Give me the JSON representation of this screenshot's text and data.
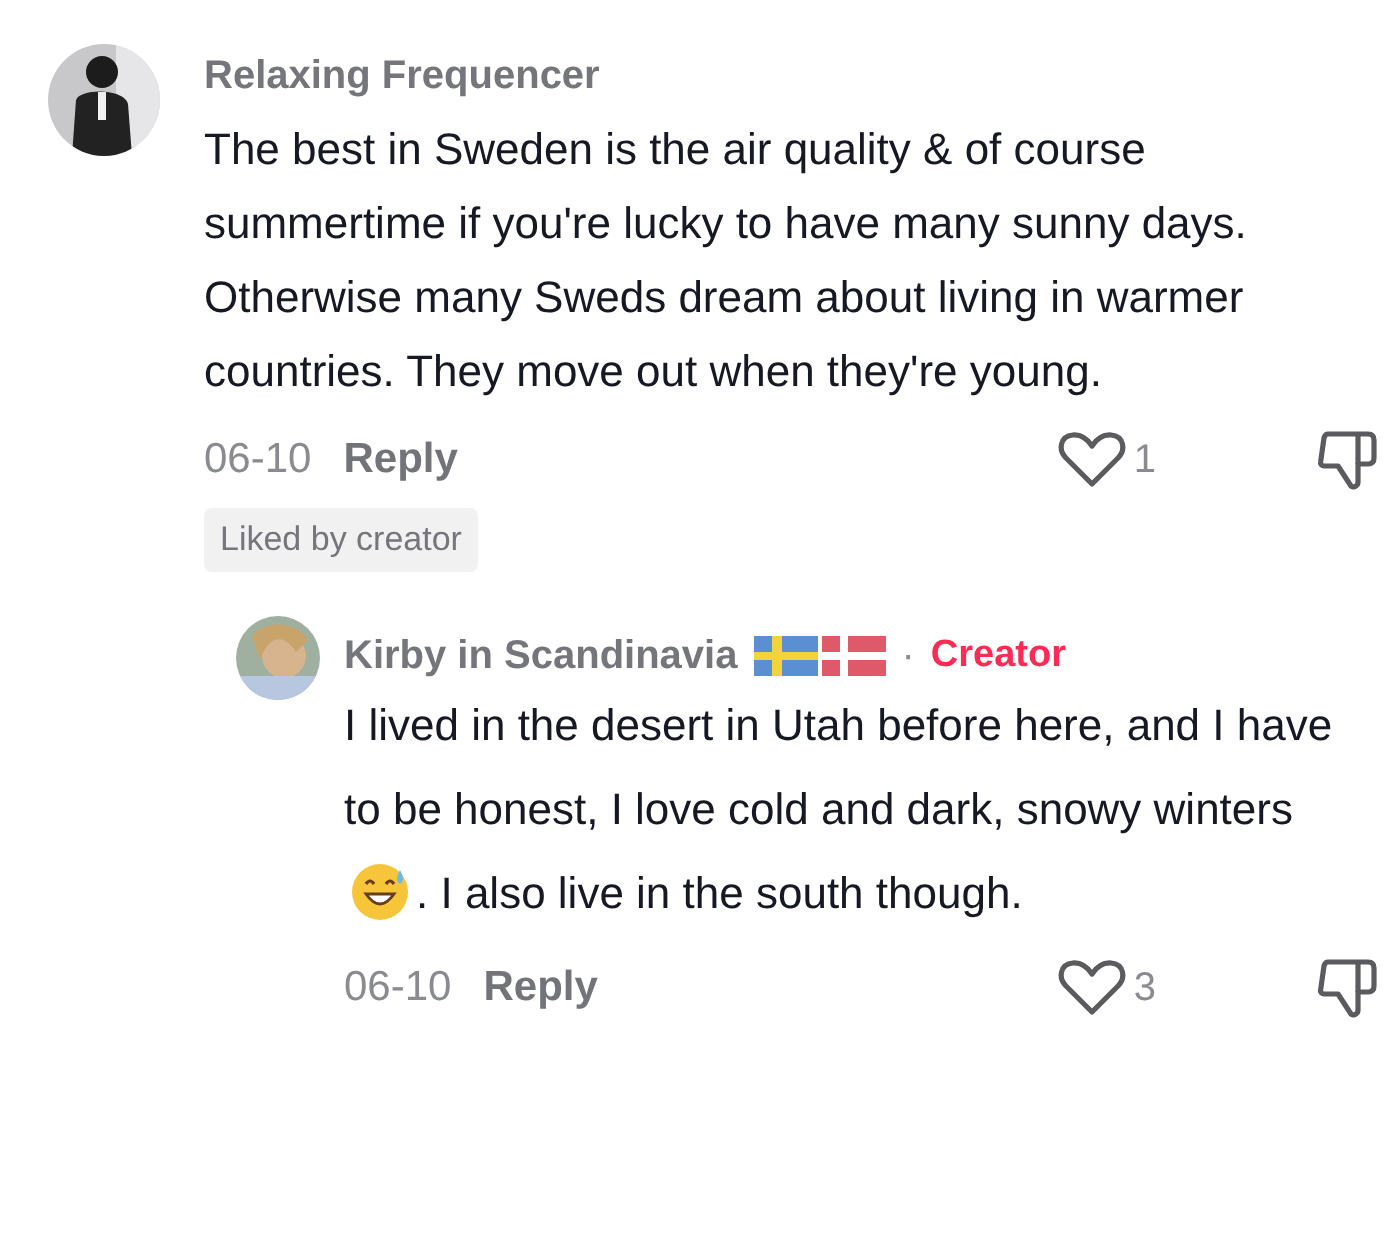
{
  "comment": {
    "author": "Relaxing Frequencer",
    "text": "The best in Sweden is the air quality & of course summertime if you're lucky to have many sunny days. Otherwise many Sweds dream about living in warmer countries. They move out when they're young.",
    "date": "06-10",
    "reply_label": "Reply",
    "likes": "1",
    "badge": "Liked by creator"
  },
  "reply": {
    "author": "Kirby in Scandinavia",
    "separator": "·",
    "role": "Creator",
    "text_before": "I lived in the desert in Utah before here, and I have to be honest, I love cold and dark, snowy winters",
    "text_after": ". I also live in the south though.",
    "date": "06-10",
    "reply_label": "Reply",
    "likes": "3"
  }
}
